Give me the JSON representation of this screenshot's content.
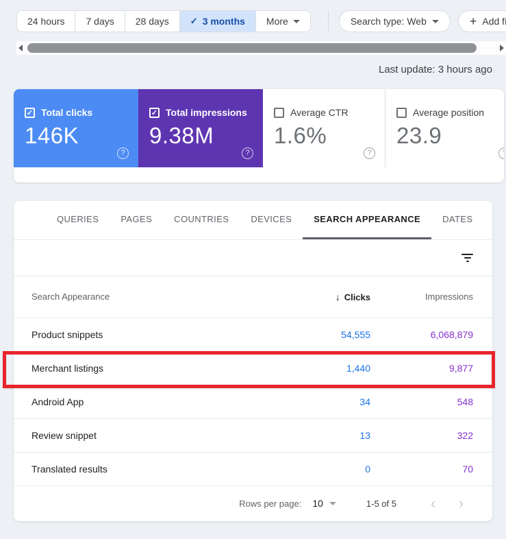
{
  "icons": {
    "check": "✓",
    "plus": "+",
    "help": "?",
    "sort_desc": "↓",
    "chevron_left": "‹",
    "chevron_right": "›"
  },
  "toolbar": {
    "date_ranges": [
      {
        "label": "24 hours",
        "selected": false
      },
      {
        "label": "7 days",
        "selected": false
      },
      {
        "label": "28 days",
        "selected": false
      },
      {
        "label": "3 months",
        "selected": true
      },
      {
        "label": "More",
        "selected": false
      }
    ],
    "search_type_label": "Search type: Web",
    "add_filter_label": "Add filter"
  },
  "status": {
    "last_update": "Last update: 3 hours ago"
  },
  "metrics": {
    "cards": [
      {
        "label": "Total clicks",
        "value": "146K",
        "checked": true,
        "color": "#4c8bf4"
      },
      {
        "label": "Total impressions",
        "value": "9.38M",
        "checked": true,
        "color": "#5e35b1"
      },
      {
        "label": "Average CTR",
        "value": "1.6%",
        "checked": false,
        "color": "#ffffff"
      },
      {
        "label": "Average position",
        "value": "23.9",
        "checked": false,
        "color": "#ffffff"
      }
    ]
  },
  "tabs": {
    "items": [
      "QUERIES",
      "PAGES",
      "COUNTRIES",
      "DEVICES",
      "SEARCH APPEARANCE",
      "DATES"
    ],
    "active": "SEARCH APPEARANCE"
  },
  "table": {
    "columns": {
      "dimension": "Search Appearance",
      "clicks": "Clicks",
      "impressions": "Impressions"
    },
    "sorted_by": "Clicks",
    "rows": [
      {
        "name": "Product snippets",
        "clicks": "54,555",
        "impressions": "6,068,879",
        "highlighted": false
      },
      {
        "name": "Merchant listings",
        "clicks": "1,440",
        "impressions": "9,877",
        "highlighted": true
      },
      {
        "name": "Android App",
        "clicks": "34",
        "impressions": "548",
        "highlighted": false
      },
      {
        "name": "Review snippet",
        "clicks": "13",
        "impressions": "322",
        "highlighted": false
      },
      {
        "name": "Translated results",
        "clicks": "0",
        "impressions": "70",
        "highlighted": false
      }
    ]
  },
  "pagination": {
    "rows_per_page_label": "Rows per page:",
    "rows_per_page_value": "10",
    "range_label": "1-5 of 5"
  },
  "colors": {
    "page_bg": "#edf1f5",
    "clicks_card_blue": "#4c8bf4",
    "impressions_card_purple": "#5e35b1",
    "selected_chip_bg": "#d2e3fc",
    "selected_chip_text": "#174ea6",
    "clicks_value_text": "#1a73e8",
    "impressions_value_text": "#8430ce",
    "highlight_red": "#e8242d"
  }
}
